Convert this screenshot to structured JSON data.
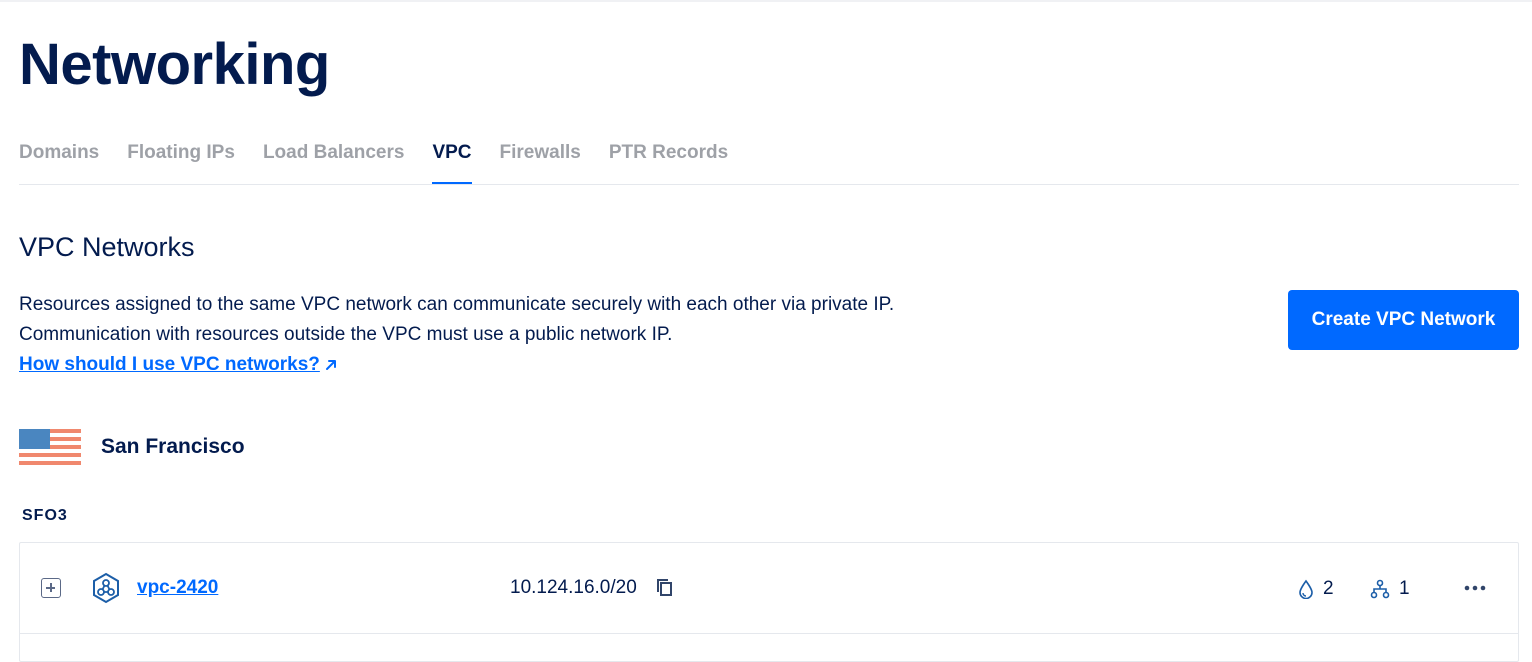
{
  "page": {
    "title": "Networking"
  },
  "tabs": [
    {
      "label": "Domains",
      "active": false
    },
    {
      "label": "Floating IPs",
      "active": false
    },
    {
      "label": "Load Balancers",
      "active": false
    },
    {
      "label": "VPC",
      "active": true
    },
    {
      "label": "Firewalls",
      "active": false
    },
    {
      "label": "PTR Records",
      "active": false
    }
  ],
  "section": {
    "title": "VPC Networks",
    "description_line1": "Resources assigned to the same VPC network can communicate securely with each other via private IP.",
    "description_line2": "Communication with resources outside the VPC must use a public network IP.",
    "help_link": "How should I use VPC networks?",
    "create_button": "Create VPC Network"
  },
  "region": {
    "name": "San Francisco",
    "flag_icon": "us-flag-icon",
    "datacenter": "SFO3"
  },
  "vpc_networks": [
    {
      "name": "vpc-2420",
      "ip_range": "10.124.16.0/20",
      "droplets": "2",
      "nodes": "1"
    }
  ],
  "colors": {
    "accent": "#0069ff",
    "text": "#031b4e",
    "muted": "#9ea1a7"
  }
}
